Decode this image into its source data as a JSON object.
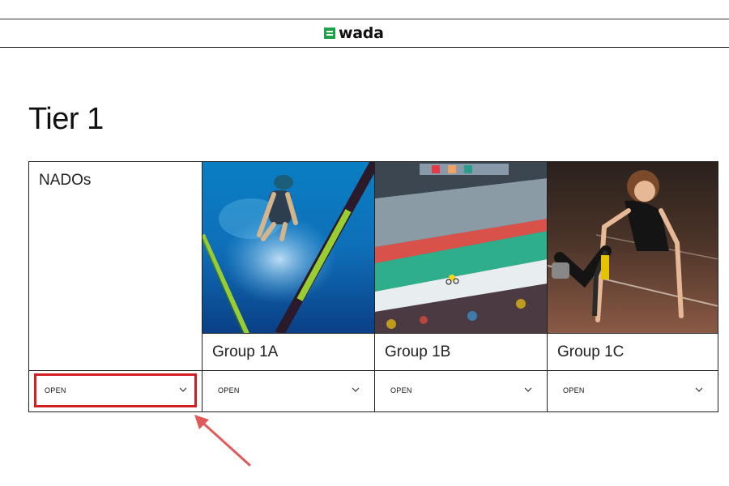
{
  "header": {
    "logo_text": "wada"
  },
  "page": {
    "title": "Tier 1"
  },
  "columns": [
    {
      "title": "NADOs",
      "open_label": "OPEN",
      "highlighted": true
    },
    {
      "title": "Group 1A",
      "open_label": "OPEN",
      "image": "swimmer-photo"
    },
    {
      "title": "Group 1B",
      "open_label": "OPEN",
      "image": "velodrome-cyclist-photo"
    },
    {
      "title": "Group 1C",
      "open_label": "OPEN",
      "image": "para-athlete-sprinter-photo"
    }
  ],
  "colors": {
    "brand_green": "#1fa34a",
    "highlight_red": "#d21f26",
    "border": "#222222"
  }
}
